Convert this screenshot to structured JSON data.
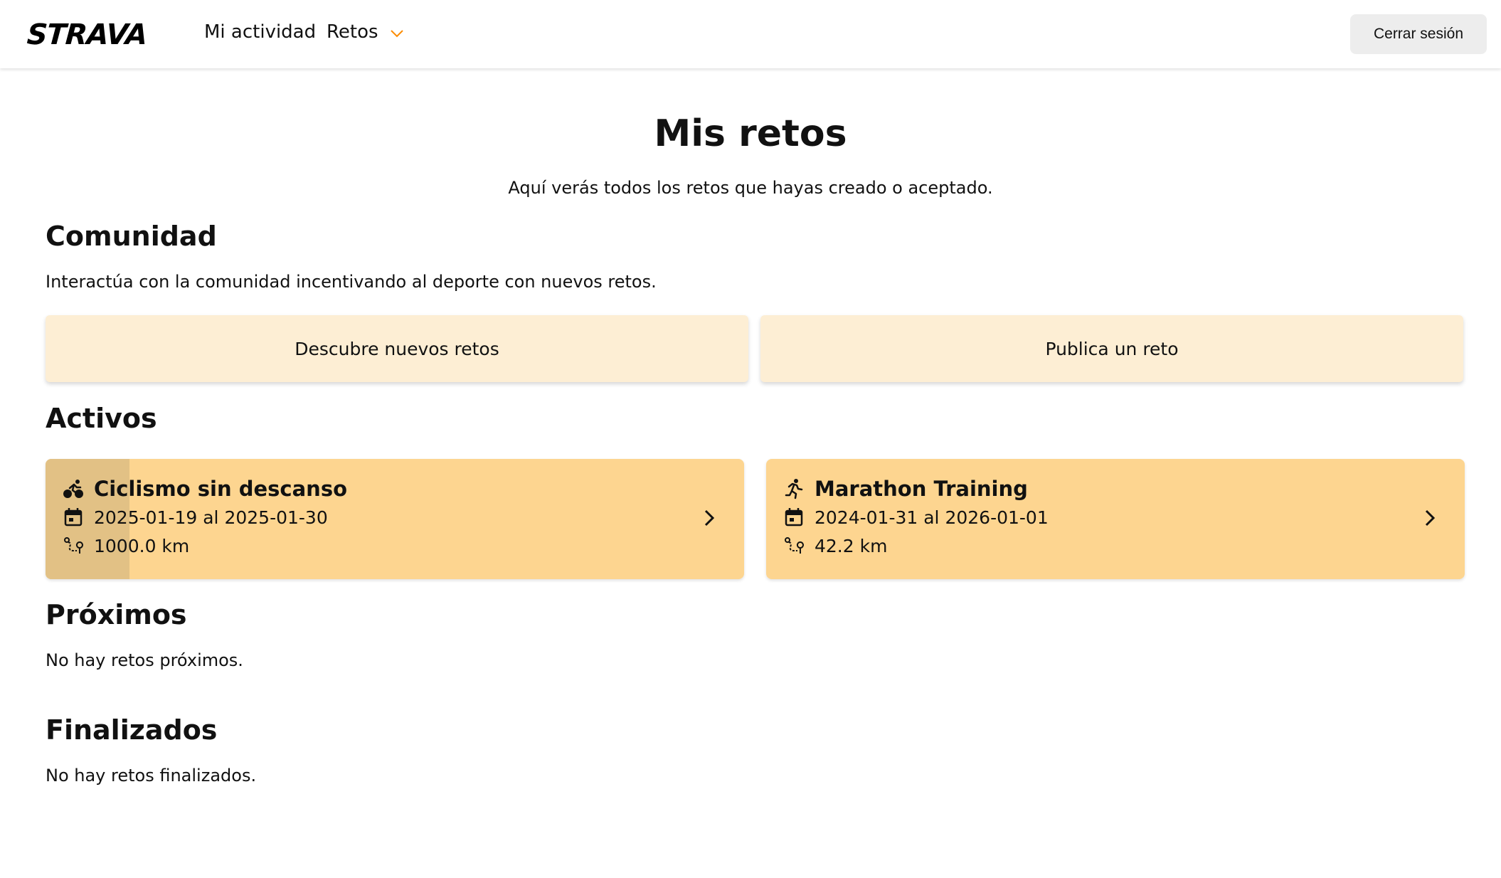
{
  "header": {
    "logo": "STRAVA",
    "nav": {
      "activity": "Mi actividad",
      "challenges": "Retos"
    },
    "logout_label": "Cerrar sesión"
  },
  "main": {
    "title": "Mis retos",
    "subtitle": "Aquí verás todos los retos que hayas creado o aceptado."
  },
  "community": {
    "heading": "Comunidad",
    "description": "Interactúa con la comunidad incentivando al deporte con nuevos retos.",
    "discover_label": "Descubre nuevos retos",
    "publish_label": "Publica un reto"
  },
  "active": {
    "heading": "Activos",
    "challenges": [
      {
        "icon": "cycling-icon",
        "name": "Ciclismo sin descanso",
        "dates": "2025-01-19 al 2025-01-30",
        "distance": "1000.0 km",
        "progress": 0.12
      },
      {
        "icon": "running-icon",
        "name": "Marathon Training",
        "dates": "2024-01-31 al 2026-01-01",
        "distance": "42.2 km",
        "progress": 0
      }
    ]
  },
  "upcoming": {
    "heading": "Próximos",
    "empty": "No hay retos próximos."
  },
  "finished": {
    "heading": "Finalizados",
    "empty": "No hay retos finalizados."
  },
  "colors": {
    "accent": "#fc8c04",
    "card_bg": "#fdd590",
    "card_progress": "#e2c185",
    "action_bg": "#fdeed4",
    "logout_bg": "#ededed"
  }
}
